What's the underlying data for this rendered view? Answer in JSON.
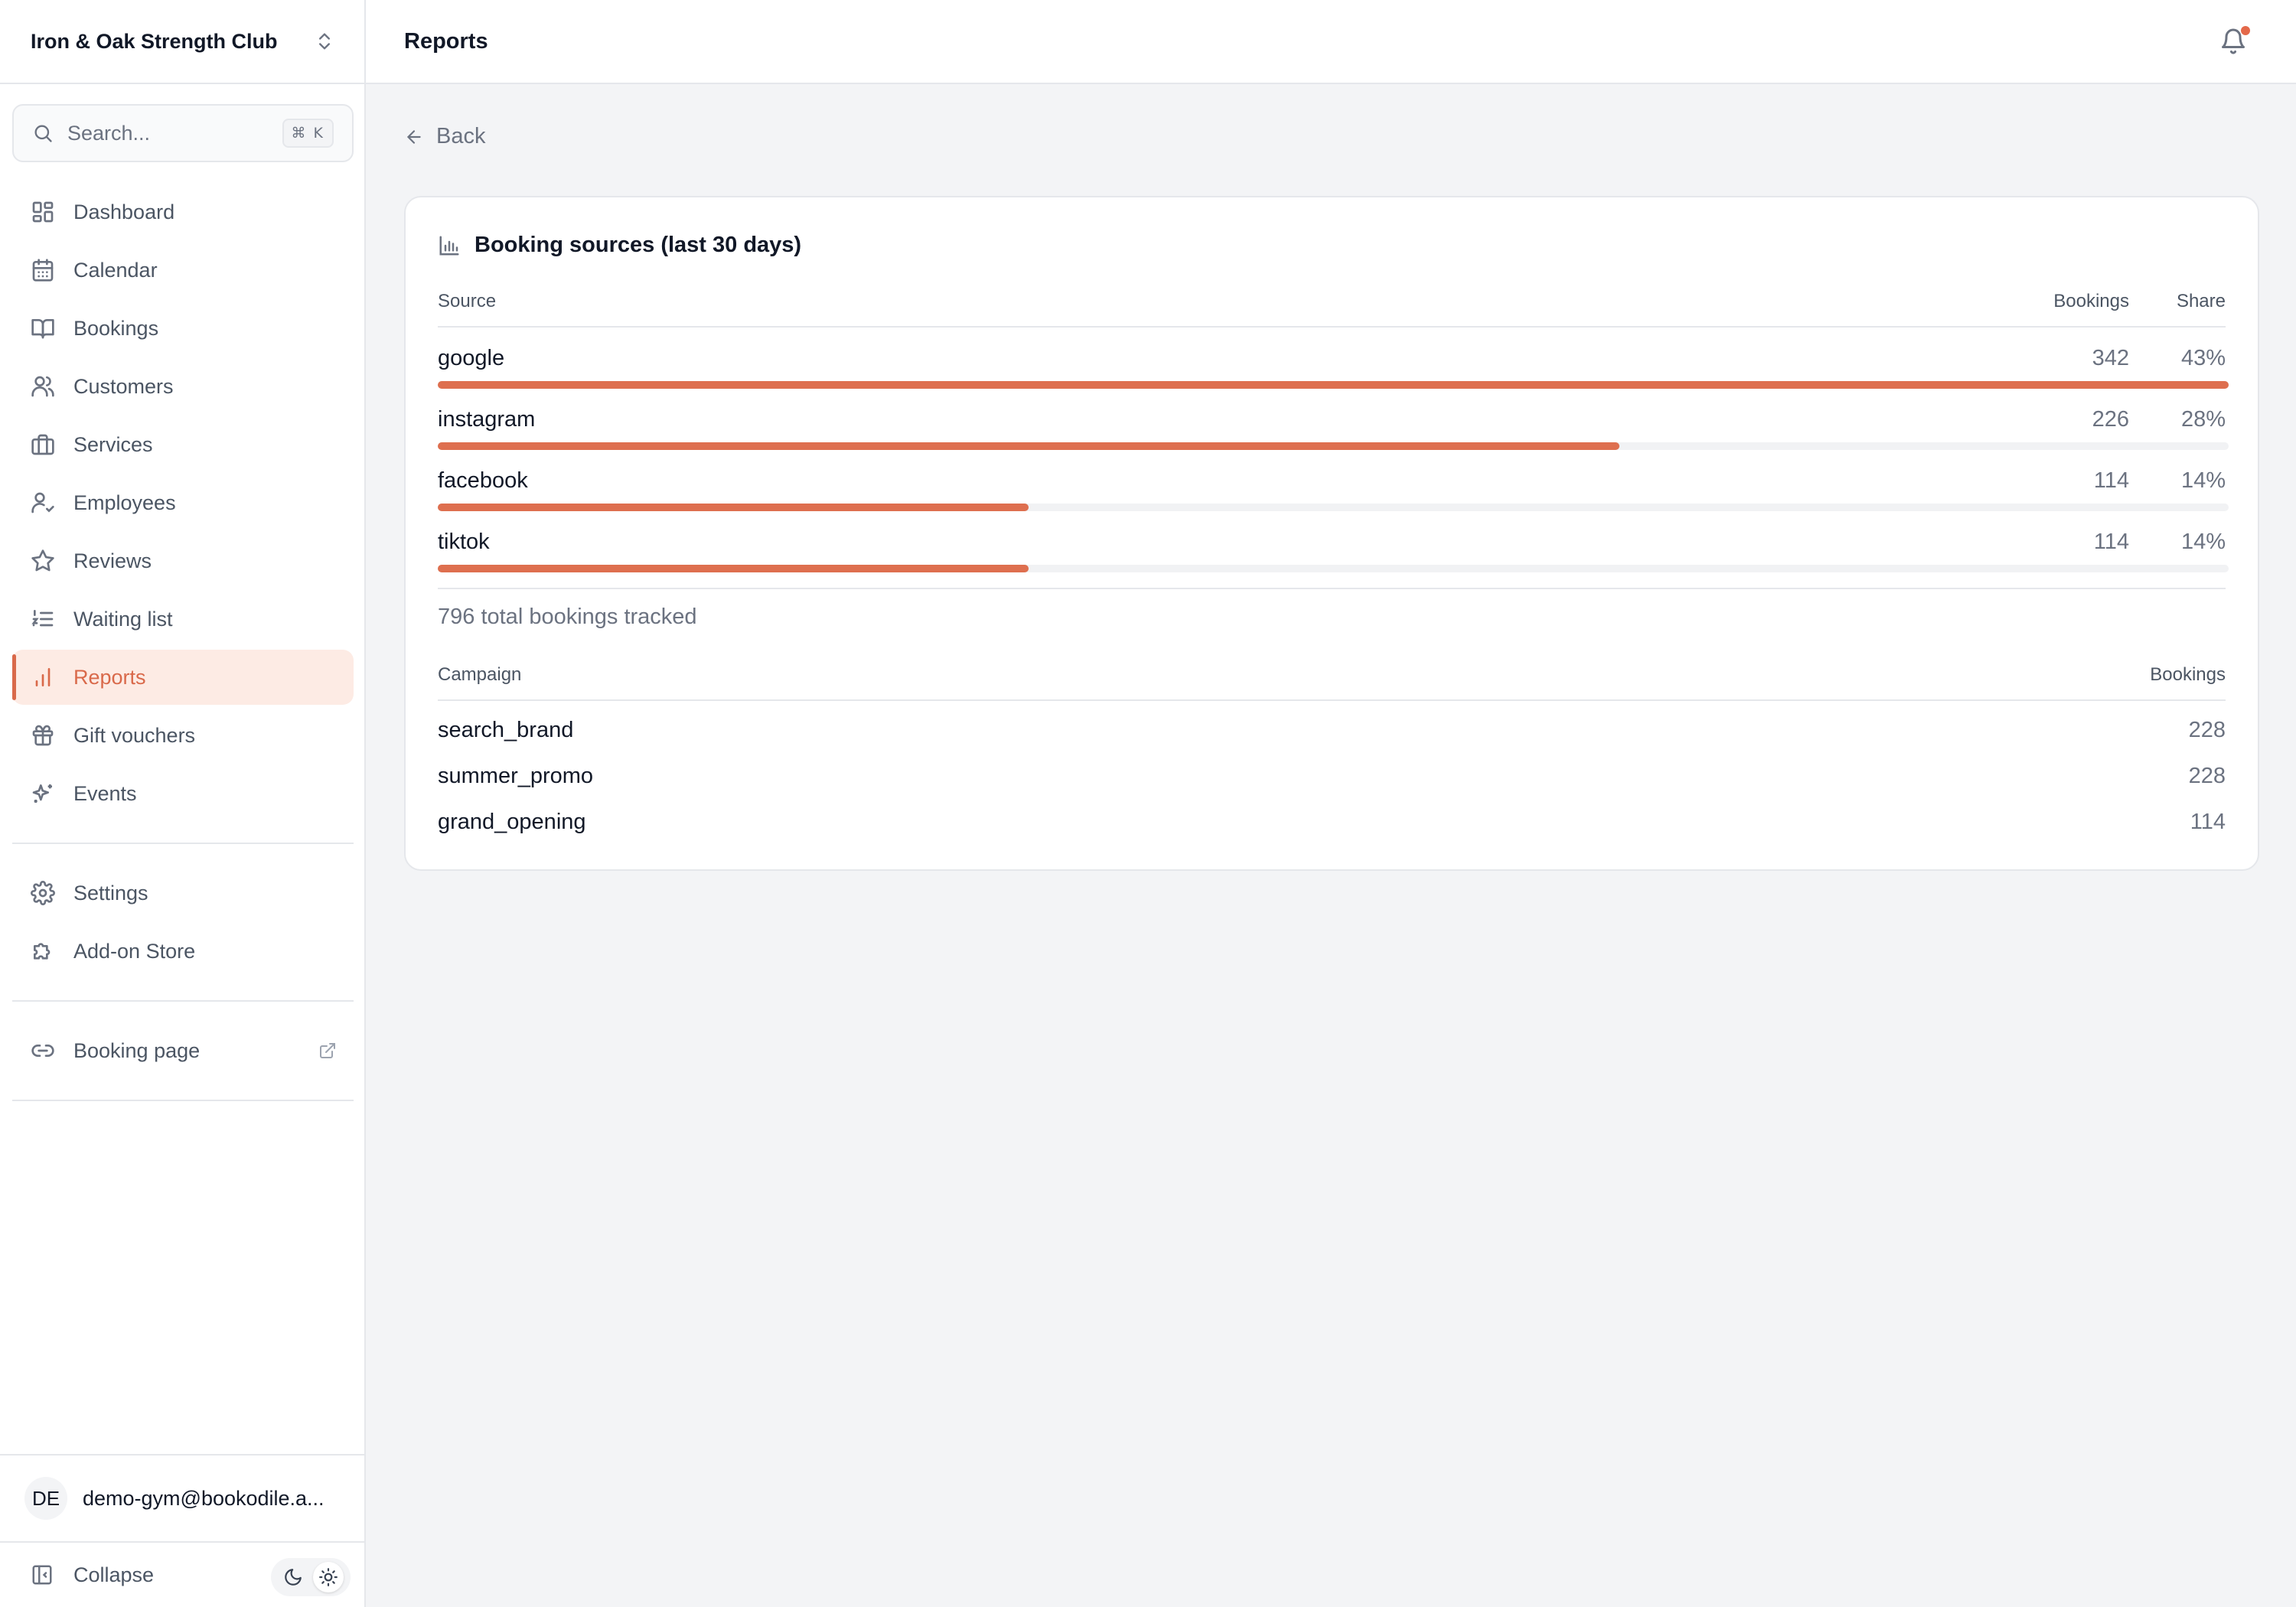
{
  "org": {
    "name": "Iron & Oak Strength Club"
  },
  "search": {
    "placeholder": "Search...",
    "shortcut": "⌘ K"
  },
  "sidebar": {
    "items": [
      {
        "label": "Dashboard",
        "icon": "dashboard-icon"
      },
      {
        "label": "Calendar",
        "icon": "calendar-icon"
      },
      {
        "label": "Bookings",
        "icon": "book-icon"
      },
      {
        "label": "Customers",
        "icon": "users-icon"
      },
      {
        "label": "Services",
        "icon": "briefcase-icon"
      },
      {
        "label": "Employees",
        "icon": "user-check-icon"
      },
      {
        "label": "Reviews",
        "icon": "star-icon"
      },
      {
        "label": "Waiting list",
        "icon": "list-icon"
      },
      {
        "label": "Reports",
        "icon": "bar-chart-icon",
        "active": true
      },
      {
        "label": "Gift vouchers",
        "icon": "gift-icon"
      },
      {
        "label": "Events",
        "icon": "sparkles-icon"
      }
    ],
    "secondary": [
      {
        "label": "Settings",
        "icon": "gear-icon"
      },
      {
        "label": "Add-on Store",
        "icon": "puzzle-icon"
      }
    ],
    "booking_page": {
      "label": "Booking page",
      "icon": "link-icon"
    },
    "user": {
      "initials": "DE",
      "email": "demo-gym@bookodile.a..."
    },
    "collapse_label": "Collapse"
  },
  "header": {
    "title": "Reports"
  },
  "main": {
    "back_label": "Back",
    "card_title": "Booking sources (last 30 days)",
    "sources_table": {
      "columns": [
        "Source",
        "Bookings",
        "Share"
      ],
      "rows": [
        {
          "source": "google",
          "bookings": "342",
          "share": "43%",
          "bar_fraction": 1.0
        },
        {
          "source": "instagram",
          "bookings": "226",
          "share": "28%",
          "bar_fraction": 0.66
        },
        {
          "source": "facebook",
          "bookings": "114",
          "share": "14%",
          "bar_fraction": 0.33
        },
        {
          "source": "tiktok",
          "bookings": "114",
          "share": "14%",
          "bar_fraction": 0.33
        }
      ]
    },
    "total_label": "796 total bookings tracked",
    "campaigns_table": {
      "columns": [
        "Campaign",
        "Bookings"
      ],
      "rows": [
        {
          "campaign": "search_brand",
          "bookings": "228"
        },
        {
          "campaign": "summer_promo",
          "bookings": "228"
        },
        {
          "campaign": "grand_opening",
          "bookings": "114"
        }
      ]
    }
  },
  "colors": {
    "accent": "#de6f4f",
    "active_bg": "#fdebe4",
    "notification_dot": "#e4694a"
  }
}
